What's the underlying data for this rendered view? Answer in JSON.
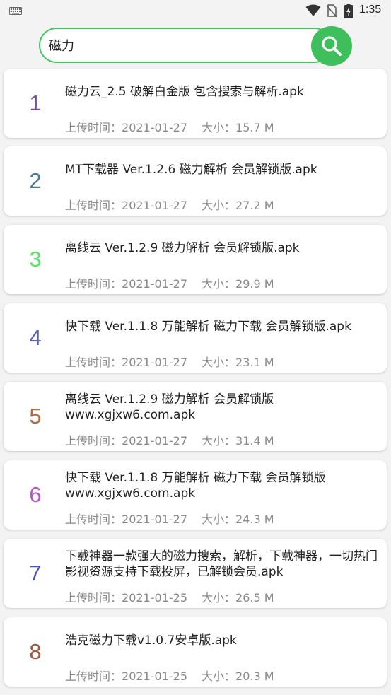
{
  "status_bar": {
    "time": "1:35",
    "icons": [
      "keyboard-icon",
      "wifi-icon",
      "no-sim-icon",
      "battery-charging-icon"
    ]
  },
  "search": {
    "query": "磁力",
    "button_icon": "search-icon",
    "accent": "#3fbf5b"
  },
  "results": [
    {
      "num": "1",
      "color": "#7a4f9e",
      "title": "磁力云_2.5 破解白金版 包含搜索与解析.apk",
      "date_label": "上传时间：",
      "date": "2021-01-27",
      "size_label": "大小：",
      "size": "15.7 M"
    },
    {
      "num": "2",
      "color": "#4a7e8c",
      "title": "MT下载器 Ver.1.2.6 磁力解析 会员解锁版.apk",
      "date_label": "上传时间：",
      "date": "2021-01-27",
      "size_label": "大小：",
      "size": "27.2 M"
    },
    {
      "num": "3",
      "color": "#5fe06a",
      "title": "离线云 Ver.1.2.9 磁力解析 会员解锁版.apk",
      "date_label": "上传时间：",
      "date": "2021-01-27",
      "size_label": "大小：",
      "size": "29.9 M"
    },
    {
      "num": "4",
      "color": "#5a5fb0",
      "title": "快下载 Ver.1.1.8 万能解析 磁力下载 会员解锁版.apk",
      "date_label": "上传时间：",
      "date": "2021-01-27",
      "size_label": "大小：",
      "size": "23.1 M"
    },
    {
      "num": "5",
      "color": "#b06e45",
      "title": "离线云 Ver.1.2.9 磁力解析 会员解锁版 www.xgjxw6.com.apk",
      "date_label": "上传时间：",
      "date": "2021-01-27",
      "size_label": "大小：",
      "size": "31.4 M"
    },
    {
      "num": "6",
      "color": "#b45cc2",
      "title": "快下载 Ver.1.1.8 万能解析 磁力下载 会员解锁版 www.xgjxw6.com.apk",
      "date_label": "上传时间：",
      "date": "2021-01-27",
      "size_label": "大小：",
      "size": "24.3 M"
    },
    {
      "num": "7",
      "color": "#4d55ad",
      "title": "下载神器一款强大的磁力搜索，解析，下载神器，一切热门影视资源支持下载投屏，已解锁会员.apk",
      "date_label": "上传时间：",
      "date": "2021-01-25",
      "size_label": "大小：",
      "size": "26.5 M"
    },
    {
      "num": "8",
      "color": "#9a5a40",
      "title": "浩克磁力下载v1.0.7安卓版.apk",
      "date_label": "上传时间：",
      "date": "2021-01-25",
      "size_label": "大小：",
      "size": "20.3 M"
    }
  ]
}
